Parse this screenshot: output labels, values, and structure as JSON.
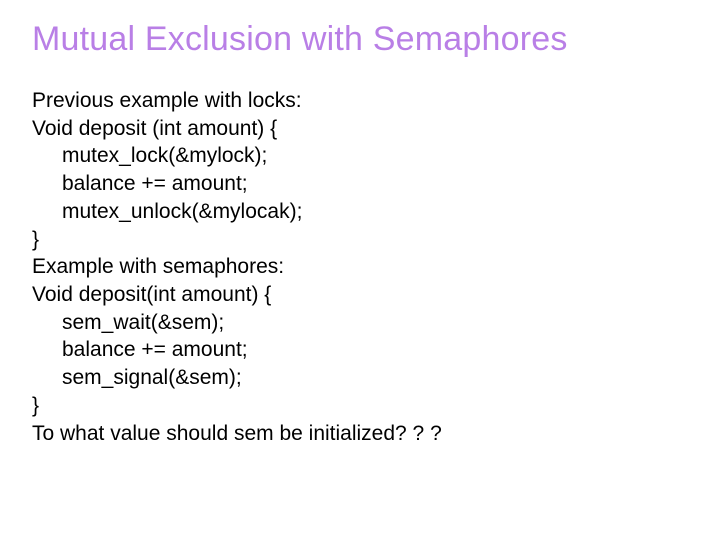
{
  "title": "Mutual Exclusion with Semaphores",
  "lines": [
    {
      "text": "Previous example with locks:",
      "indent": false
    },
    {
      "text": "Void deposit (int amount) {",
      "indent": false
    },
    {
      "text": "mutex_lock(&mylock);",
      "indent": true
    },
    {
      "text": "balance += amount;",
      "indent": true
    },
    {
      "text": "mutex_unlock(&mylocak);",
      "indent": true
    },
    {
      "text": "}",
      "indent": false
    },
    {
      "text": "Example with semaphores:",
      "indent": false
    },
    {
      "text": "Void deposit(int amount) {",
      "indent": false
    },
    {
      "text": "sem_wait(&sem);",
      "indent": true
    },
    {
      "text": "balance += amount;",
      "indent": true
    },
    {
      "text": "sem_signal(&sem);",
      "indent": true
    },
    {
      "text": "}",
      "indent": false
    },
    {
      "text": "To what value should sem be initialized? ? ?",
      "indent": false
    }
  ]
}
